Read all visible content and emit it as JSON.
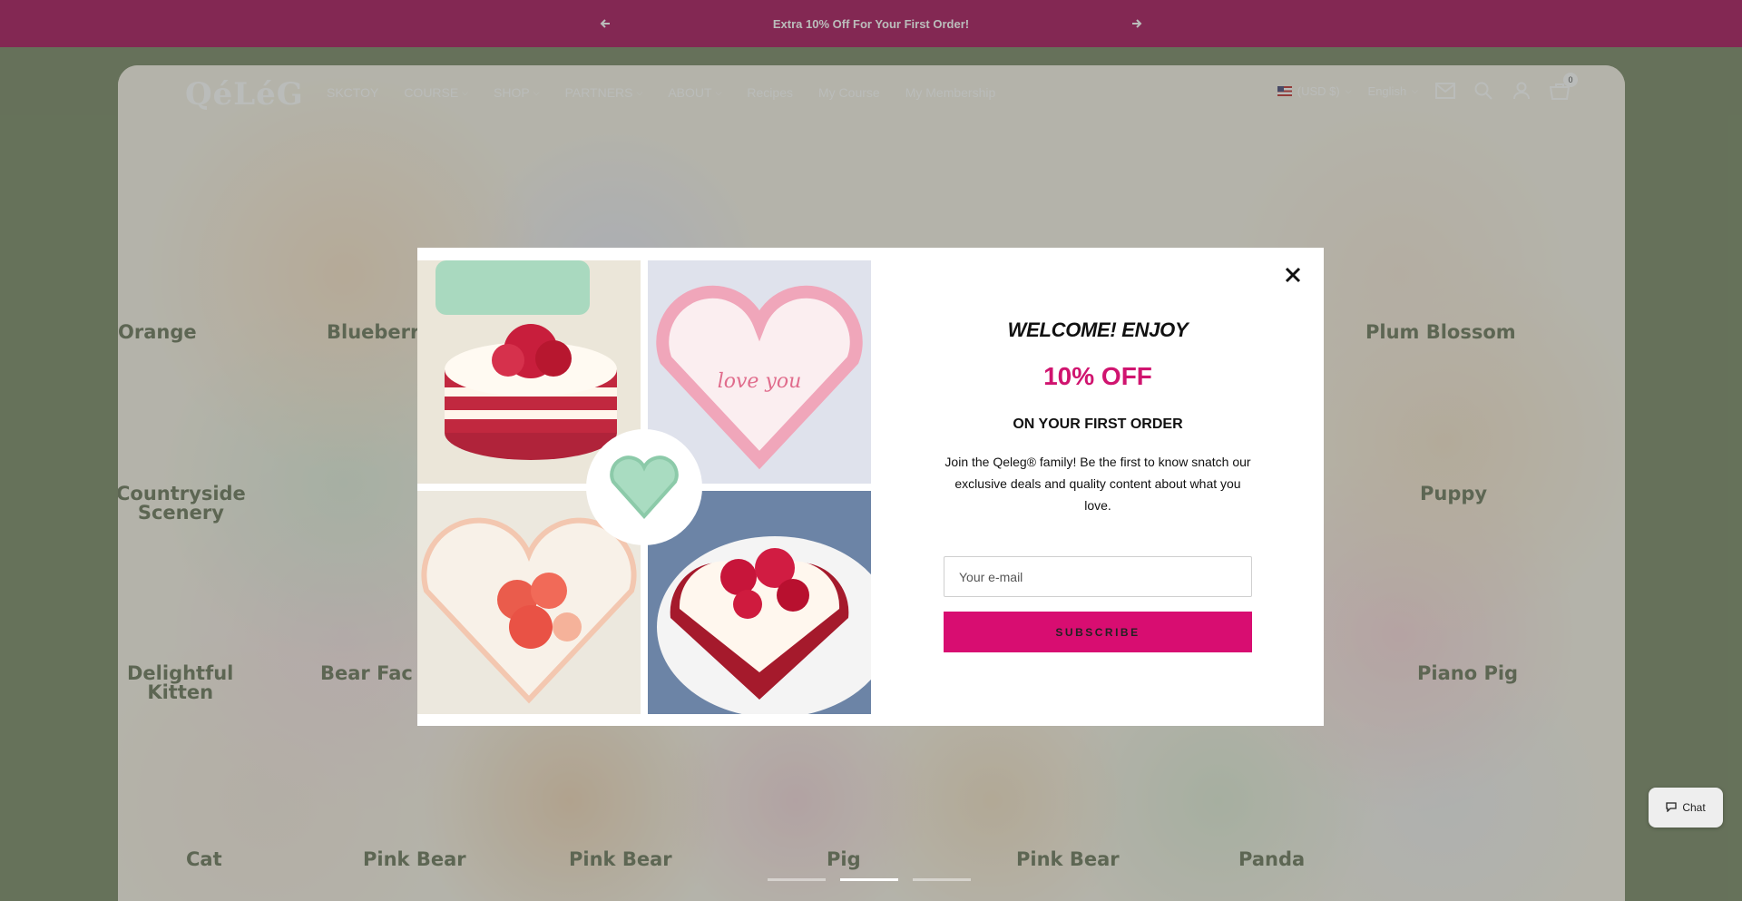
{
  "announcement": {
    "text": "Extra 10% Off For Your First Order!",
    "prev_icon": "arrow-left-icon",
    "next_icon": "arrow-right-icon"
  },
  "header": {
    "logo": "QéLéG",
    "nav": [
      {
        "label": "SKCTOY",
        "dropdown": false
      },
      {
        "label": "COURSE",
        "dropdown": true
      },
      {
        "label": "SHOP",
        "dropdown": true
      },
      {
        "label": "PARTNERS",
        "dropdown": true
      },
      {
        "label": "ABOUT",
        "dropdown": true
      },
      {
        "label": "Recipes",
        "dropdown": false
      },
      {
        "label": "My Course",
        "dropdown": false
      },
      {
        "label": "My Membership",
        "dropdown": false
      }
    ],
    "currency": "(USD $)",
    "language": "English",
    "cart_count": "0",
    "icons": [
      "mail-icon",
      "search-icon",
      "account-icon",
      "cart-icon"
    ]
  },
  "hero": {
    "tiles": [
      {
        "label": "Orange"
      },
      {
        "label": "Blueberr"
      },
      {
        "label": "Plum Blossom"
      },
      {
        "label": "Countryside\nScenery"
      },
      {
        "label": "Puppy"
      },
      {
        "label": "Delightful\nKitten"
      },
      {
        "label": "Bear Fac"
      },
      {
        "label": "Piano Pig"
      },
      {
        "label": "Cat"
      },
      {
        "label": "Pink Bear"
      },
      {
        "label": "Pink Bear"
      },
      {
        "label": "Pig"
      },
      {
        "label": "Pink Bear"
      },
      {
        "label": "Panda"
      }
    ],
    "slides": 3,
    "active_slide": 1
  },
  "modal": {
    "heading": "WELCOME! ENJOY",
    "discount": "10% OFF",
    "subheading": "ON YOUR FIRST ORDER",
    "body": "Join the Qeleg® family! Be the first to know snatch our exclusive deals and quality content about what you love.",
    "email_placeholder": "Your e-mail",
    "email_value": "",
    "button": "SUBSCRIBE",
    "close_icon": "close-icon",
    "accent_color": "#d80d71"
  },
  "chat": {
    "label": "Chat",
    "icon": "chat-bubble-icon"
  },
  "colors": {
    "announcement_bg": "#a0004f",
    "discount_text": "#d0146f"
  }
}
